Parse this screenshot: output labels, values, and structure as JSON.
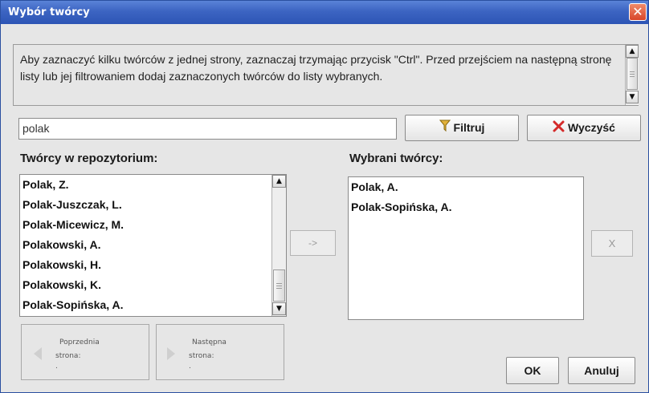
{
  "window": {
    "title": "Wybór twórcy",
    "close_glyph": "✕"
  },
  "info": {
    "text": "Aby zaznaczyć kilku twórców z jednej strony, zaznaczaj trzymając przycisk \"Ctrl\". Przed przejściem na następną stronę listy lub jej filtrowaniem dodaj zaznaczonych twórców do listy wybranych."
  },
  "filter": {
    "value": "polak",
    "filter_button": "Filtruj",
    "clear_button": "Wyczyść",
    "filter_icon": "funnel-icon",
    "clear_icon": "red-x-icon"
  },
  "repository": {
    "label": "Twórcy w repozytorium:",
    "items": [
      "Polak, Z.",
      "Polak-Juszczak, L.",
      "Polak-Micewicz, M.",
      "Polakowski, A.",
      "Polakowski, H.",
      "Polakowski, K.",
      "Polak-Sopińska, A."
    ]
  },
  "selected": {
    "label": "Wybrani twórcy:",
    "items": [
      "Polak, A.",
      "Polak-Sopińska, A."
    ]
  },
  "buttons": {
    "add": "->",
    "remove": "X",
    "ok": "OK",
    "cancel": "Anuluj"
  },
  "paging": {
    "prev_line1": "Poprzednia",
    "prev_line2": "strona:",
    "prev_line3": ".",
    "next_line1": "Następna",
    "next_line2": "strona:",
    "next_line3": "."
  },
  "colors": {
    "titlebar": "#3c64c2",
    "clear_icon": "#d42a2a",
    "filter_icon": "#d8a21a"
  }
}
